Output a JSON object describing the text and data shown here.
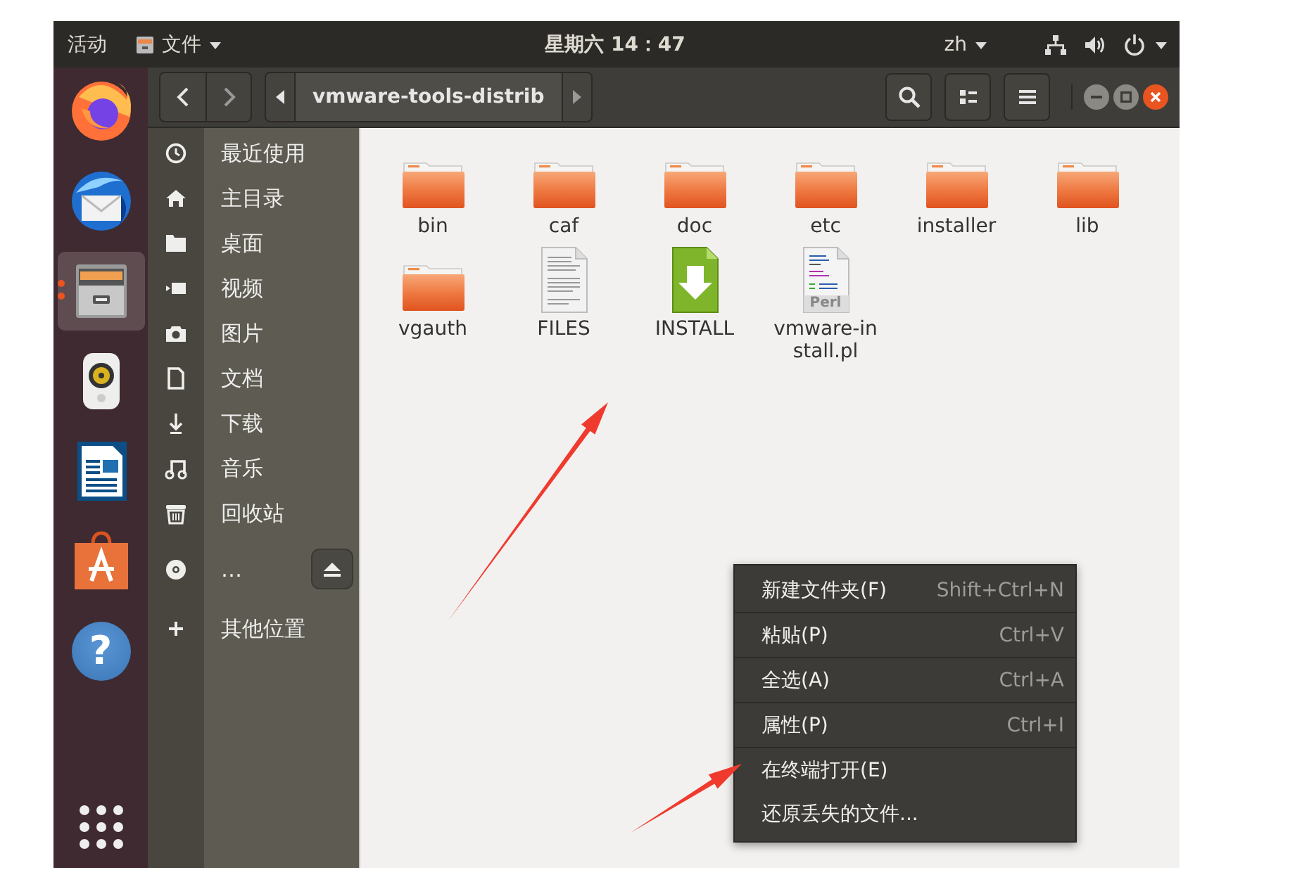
{
  "top_bar": {
    "activities": "活动",
    "app_menu": "文件",
    "clock": "星期六 14：47",
    "input_method": "zh"
  },
  "dock": {
    "items": [
      {
        "kind": "firefox",
        "selected": false,
        "running": false
      },
      {
        "kind": "mail",
        "selected": false,
        "running": false
      },
      {
        "kind": "files",
        "selected": true,
        "running": true
      },
      {
        "kind": "speaker",
        "selected": false,
        "running": false
      },
      {
        "kind": "writer",
        "selected": false,
        "running": false
      },
      {
        "kind": "store",
        "selected": false,
        "running": false
      },
      {
        "kind": "help",
        "selected": false,
        "running": false,
        "glyph": "?"
      }
    ]
  },
  "header": {
    "path": "vmware-tools-distrib"
  },
  "sidebar": {
    "items": [
      {
        "label": "最近使用",
        "ejectable": false
      },
      {
        "label": "主目录",
        "ejectable": false
      },
      {
        "label": "桌面",
        "ejectable": false
      },
      {
        "label": "视频",
        "ejectable": false
      },
      {
        "label": "图片",
        "ejectable": false
      },
      {
        "label": "文档",
        "ejectable": false
      },
      {
        "label": "下载",
        "ejectable": false
      },
      {
        "label": "音乐",
        "ejectable": false
      },
      {
        "label": "回收站",
        "ejectable": false
      },
      {
        "label": "…",
        "ejectable": true
      },
      {
        "label": "其他位置",
        "ejectable": false
      }
    ]
  },
  "files": [
    {
      "kind": "folder",
      "name": "bin"
    },
    {
      "kind": "folder",
      "name": "caf"
    },
    {
      "kind": "folder",
      "name": "doc"
    },
    {
      "kind": "folder",
      "name": "etc"
    },
    {
      "kind": "folder",
      "name": "installer"
    },
    {
      "kind": "folder",
      "name": "lib"
    },
    {
      "kind": "folder",
      "name": "vgauth"
    },
    {
      "kind": "text",
      "name": "FILES"
    },
    {
      "kind": "installer",
      "name": "INSTALL"
    },
    {
      "kind": "script",
      "name": "vmware-install.pl",
      "badge": "Perl"
    }
  ],
  "context_menu": {
    "items": [
      {
        "label": "新建文件夹(F)",
        "shortcut": "Shift+Ctrl+N",
        "separator_after": true
      },
      {
        "label": "粘贴(P)",
        "shortcut": "Ctrl+V",
        "separator_after": true
      },
      {
        "label": "全选(A)",
        "shortcut": "Ctrl+A",
        "separator_after": true
      },
      {
        "label": "属性(P)",
        "shortcut": "Ctrl+I",
        "separator_after": true
      },
      {
        "label": "在终端打开(E)",
        "separator_after": false
      },
      {
        "label": "还原丢失的文件...",
        "separator_after": false
      }
    ]
  },
  "annotation_arrows": [
    {
      "kind": "arrow"
    },
    {
      "kind": "arrow"
    }
  ]
}
